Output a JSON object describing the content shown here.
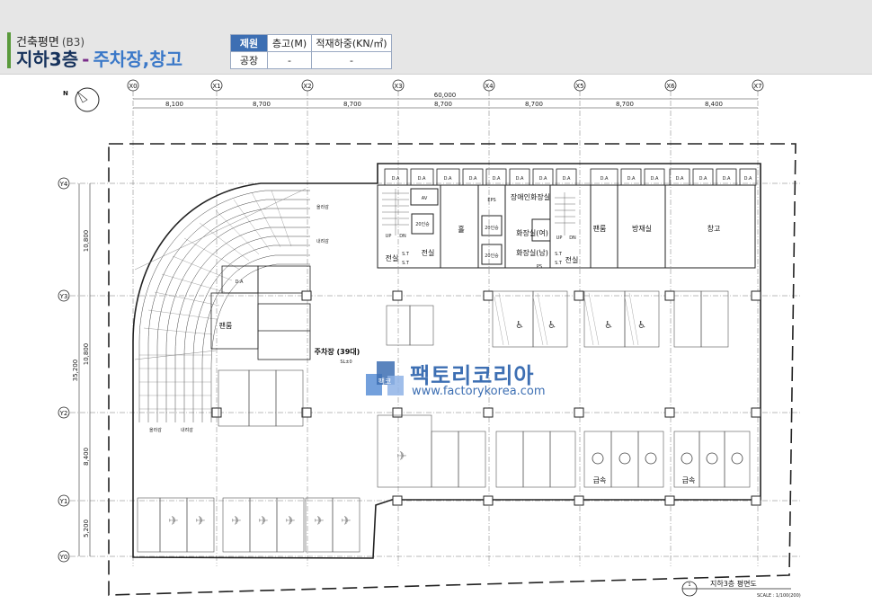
{
  "header": {
    "title": "건축평면",
    "floor_code": "(B3)",
    "floor": "지하3층",
    "use": "주차장,창고"
  },
  "spec_table": {
    "headers": [
      "제원",
      "층고(M)",
      "적재하중(KN/㎡)"
    ],
    "row": [
      "공장",
      "-",
      "-"
    ]
  },
  "plan": {
    "columns": [
      "X0",
      "X1",
      "X2",
      "X3",
      "X4",
      "X5",
      "X6",
      "X7"
    ],
    "rows": [
      "Y4",
      "Y3",
      "Y2",
      "Y1",
      "Y0"
    ],
    "total_width": "60,000",
    "column_spans": [
      "8,100",
      "8,700",
      "8,700",
      "8,700",
      "8,700",
      "8,700",
      "8,400"
    ],
    "total_height": "35,200",
    "row_spans": [
      "10,800",
      "10,800",
      "8,400",
      "5,200"
    ],
    "rooms": {
      "da": "D.A",
      "av": "AV",
      "eps": "EPS",
      "accessible_wc": "장애인화장실",
      "wc_f": "화장실(여)",
      "wc_m": "화장실(남)",
      "ps": "PS",
      "hall": "홀",
      "elec": "전실",
      "fan": "팬룸",
      "disaster": "방재실",
      "storage": "창고",
      "parking": "주차장 (39대)",
      "parking_sl": "SL±0",
      "charging": "급속",
      "persons": "20인승",
      "up": "UP",
      "dn": "DN",
      "st": "S.T"
    },
    "ramp_labels": [
      "올라감",
      "내려감"
    ],
    "caption_no": "1",
    "caption": "지하3층 평면도",
    "scale": "SCALE : 1/100(200)"
  },
  "watermark": {
    "logo_text": "팩코",
    "name": "팩토리코리아",
    "url": "www.factorykorea.com"
  },
  "colors": {
    "title_blue": "#16325c",
    "accent_green": "#5a9a3c",
    "table_header": "#3d6fb3",
    "watermark": "#3d6fb3"
  }
}
